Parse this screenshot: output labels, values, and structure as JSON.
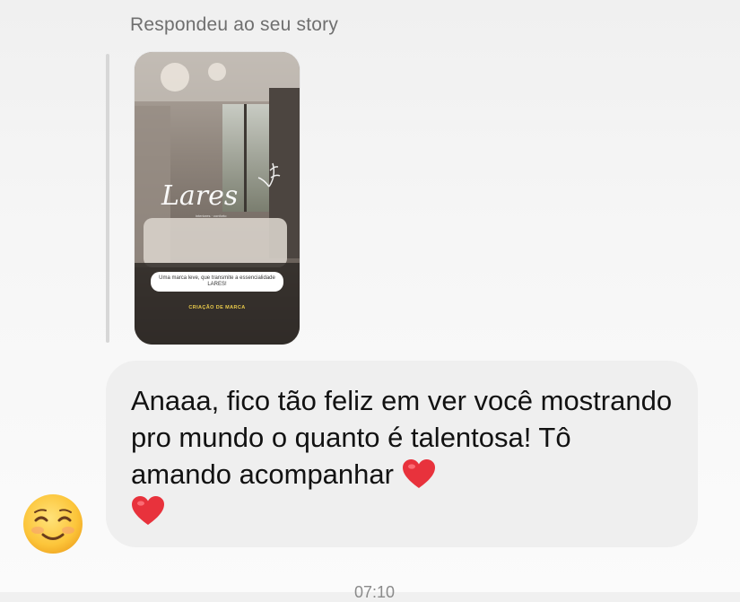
{
  "story_reply": {
    "label": "Respondeu ao seu story",
    "thumbnail": {
      "brand": "Lares",
      "caption": "Uma marca leve, que transmite a essencialidade LARES!",
      "footer": "CRIAÇÃO DE MARCA"
    }
  },
  "message": {
    "text": "Anaaa, fico tão feliz em ver você mostrando pro mundo o quanto é talentosa! Tô amando acompanhar",
    "trailing_emoji": [
      "red-heart",
      "red-heart"
    ]
  },
  "sender_avatar": "smiling-face-emoji",
  "timestamp": "07:10",
  "colors": {
    "bubble": "#efefef",
    "label": "#6f6f6f",
    "heart": "#e8323c"
  }
}
